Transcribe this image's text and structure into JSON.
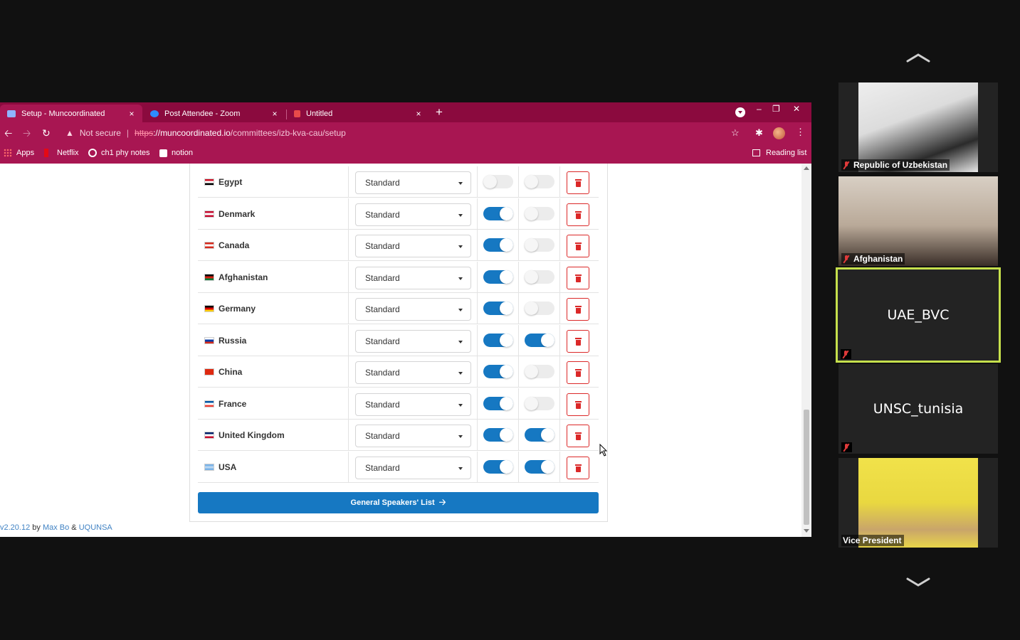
{
  "browser": {
    "tabs": [
      {
        "title": "Setup - Muncoordinated",
        "active": true,
        "icon_color": "#8fb3ff"
      },
      {
        "title": "Post Attendee - Zoom",
        "active": false,
        "icon_color": "#2d8cff"
      },
      {
        "title": "Untitled",
        "active": false,
        "icon_color": "#e84a4a"
      }
    ],
    "tab_close_glyph": "×",
    "new_tab_glyph": "+",
    "address": {
      "warning": "Not secure",
      "scheme": "https",
      "host": "://muncoordinated.io",
      "path": "/committees/izb-kva-cau/setup"
    },
    "bookmarks": [
      {
        "label": "Apps",
        "icon": "apps-grid-icon"
      },
      {
        "label": "Netflix",
        "icon": "netflix-icon"
      },
      {
        "label": "ch1 phy notes",
        "icon": "globe-icon"
      },
      {
        "label": "notion",
        "icon": "notion-icon"
      }
    ],
    "reading_list": "Reading list"
  },
  "setup": {
    "rows": [
      {
        "country": "Egypt",
        "rank": "Standard",
        "present": false,
        "voting": false,
        "flag": [
          "#ce1126",
          "#ffffff",
          "#000000"
        ]
      },
      {
        "country": "Denmark",
        "rank": "Standard",
        "present": true,
        "voting": false,
        "flag": [
          "#c60c30",
          "#ffffff",
          "#c60c30"
        ]
      },
      {
        "country": "Canada",
        "rank": "Standard",
        "present": true,
        "voting": false,
        "flag": [
          "#d52b1e",
          "#ffffff",
          "#d52b1e"
        ]
      },
      {
        "country": "Afghanistan",
        "rank": "Standard",
        "present": true,
        "voting": false,
        "flag": [
          "#000000",
          "#d32011",
          "#007a36"
        ]
      },
      {
        "country": "Germany",
        "rank": "Standard",
        "present": true,
        "voting": false,
        "flag": [
          "#000000",
          "#dd0000",
          "#ffce00"
        ]
      },
      {
        "country": "Russia",
        "rank": "Standard",
        "present": true,
        "voting": true,
        "flag": [
          "#ffffff",
          "#0039a6",
          "#d52b1e"
        ]
      },
      {
        "country": "China",
        "rank": "Standard",
        "present": true,
        "voting": false,
        "flag": [
          "#de2910",
          "#de2910",
          "#de2910"
        ]
      },
      {
        "country": "France",
        "rank": "Standard",
        "present": true,
        "voting": false,
        "flag": [
          "#0055a4",
          "#ffffff",
          "#ef4135"
        ]
      },
      {
        "country": "United Kingdom",
        "rank": "Standard",
        "present": true,
        "voting": true,
        "flag": [
          "#012169",
          "#ffffff",
          "#c8102e"
        ]
      },
      {
        "country": "USA",
        "rank": "Standard",
        "present": true,
        "voting": true,
        "flag": [
          "#7ab3e8",
          "#b9d7f2",
          "#7ab3e8"
        ]
      }
    ],
    "next_button": "General Speakers' List",
    "footer": {
      "version": "v2.20.12",
      "by": " by ",
      "author": "Max Bo",
      "amp": " & ",
      "org": "UQUNSA"
    }
  },
  "zoom": {
    "participants": [
      {
        "name": "Republic of Uzbekistan",
        "video": true,
        "muted": true,
        "speaking": false
      },
      {
        "name": "Afghanistan",
        "video": true,
        "muted": true,
        "speaking": false
      },
      {
        "name": "UAE_BVC",
        "video": false,
        "muted": true,
        "speaking": true
      },
      {
        "name": "UNSC_tunisia",
        "video": false,
        "muted": true,
        "speaking": false
      },
      {
        "name": "Vice President",
        "video": true,
        "muted": false,
        "speaking": false
      }
    ]
  },
  "colors": {
    "accent": "#1678c2",
    "danger": "#db2828",
    "browser_chrome": "#a81652",
    "speaking_border": "#c6e04c"
  }
}
